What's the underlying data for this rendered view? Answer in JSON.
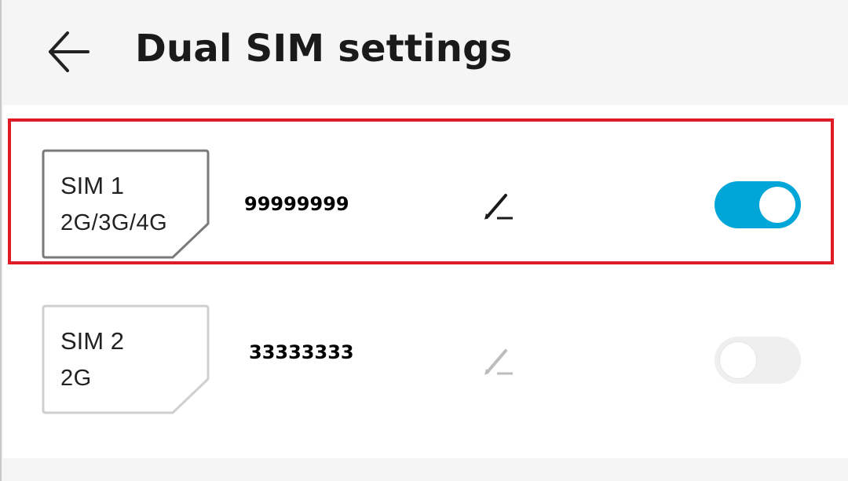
{
  "header": {
    "title": "Dual SIM settings",
    "back_icon": "arrow-left-icon"
  },
  "sims": [
    {
      "name": "SIM 1",
      "network": "2G/3G/4G",
      "number": "99999999",
      "edit_icon": "pencil-icon",
      "enabled": true,
      "highlighted": true
    },
    {
      "name": "SIM 2",
      "network": "2G",
      "number": "33333333",
      "edit_icon": "pencil-icon",
      "enabled": false,
      "highlighted": false
    }
  ],
  "colors": {
    "toggle_on": "#00a6d8",
    "toggle_off": "#efefef",
    "highlight": "#e01b24",
    "active_card_border": "#7a7a7a",
    "inactive_card_border": "#cfcfcf"
  }
}
